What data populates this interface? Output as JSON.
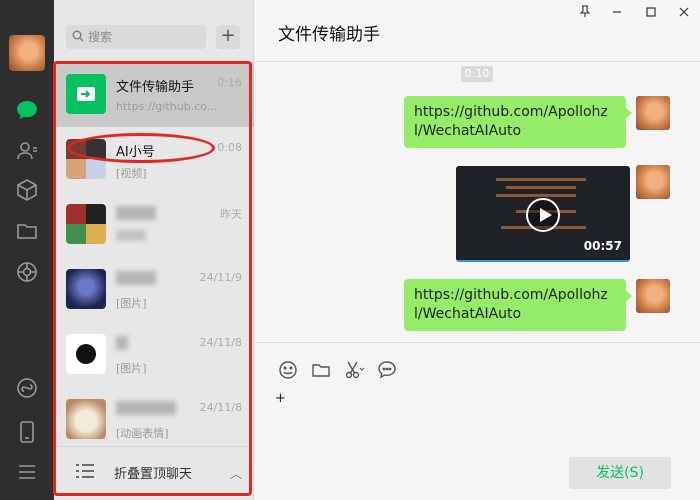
{
  "sidebar": {
    "icons": [
      "avatar",
      "chat-icon",
      "contacts-icon",
      "favorites-icon",
      "folder-icon",
      "moments-icon",
      "mini-program-icon",
      "phone-icon",
      "menu-icon"
    ],
    "accent_color": "#07c160"
  },
  "search": {
    "placeholder": "搜索",
    "add_label": "+"
  },
  "chats": [
    {
      "name": "文件传输助手",
      "time": "0:16",
      "preview": "https://github.co...",
      "icon": "file-transfer-icon"
    },
    {
      "name": "AI小号",
      "time": "0:08",
      "preview": "[视频]",
      "icon": "group-avatar-icon"
    },
    {
      "name": "",
      "time": "昨天",
      "preview": "",
      "icon": "group-avatar-icon"
    },
    {
      "name": "",
      "time": "24/11/9",
      "preview": "[图片]",
      "icon": "avatar-icon"
    },
    {
      "name": "",
      "time": "24/11/8",
      "preview": "[图片]",
      "icon": "avatar-icon"
    },
    {
      "name": "",
      "time": "24/11/8",
      "preview": "[动画表情]",
      "icon": "avatar-icon"
    }
  ],
  "fold": {
    "label": "折叠置顶聊天",
    "caret": "︿"
  },
  "chat": {
    "title": "文件传输助手",
    "window_controls": [
      "pin-icon",
      "minimize-icon",
      "maximize-icon",
      "close-icon"
    ],
    "timestamp": "0:10",
    "messages": [
      {
        "type": "text",
        "text": "https://github.com/Apollohzl/WechatAIAuto"
      },
      {
        "type": "video",
        "duration": "00:57"
      },
      {
        "type": "text",
        "text": "https://github.com/Apollohzl/WechatAIAuto"
      }
    ]
  },
  "composer": {
    "tools": [
      "emoji-icon",
      "folder-icon",
      "scissors-icon",
      "chat-bubble-icon"
    ],
    "input_value": "+",
    "send_label": "发送(S)"
  }
}
